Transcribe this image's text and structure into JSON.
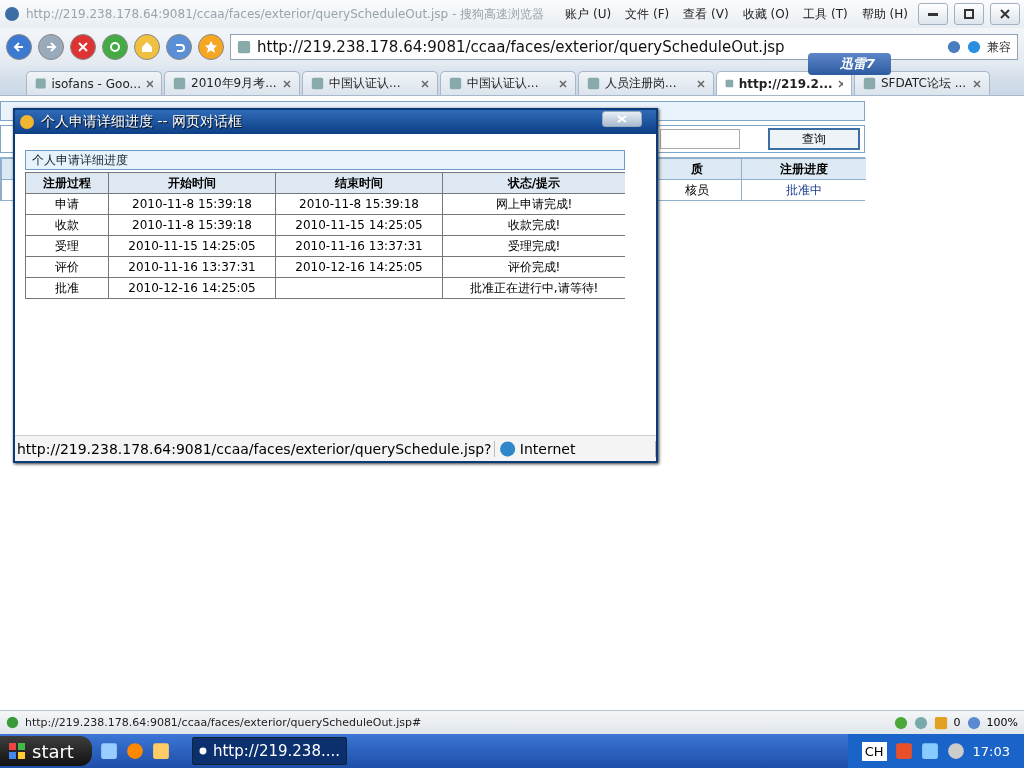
{
  "browser": {
    "title": "http://219.238.178.64:9081/ccaa/faces/exterior/queryScheduleOut.jsp - 搜狗高速浏览器",
    "menu": [
      {
        "label": "账户 (U)"
      },
      {
        "label": "文件 (F)"
      },
      {
        "label": "查看 (V)"
      },
      {
        "label": "收藏 (O)"
      },
      {
        "label": "工具 (T)"
      },
      {
        "label": "帮助 (H)"
      }
    ],
    "address": "http://219.238.178.64:9081/ccaa/faces/exterior/queryScheduleOut.jsp",
    "compat_label": "兼容",
    "download_badge": "迅雷7",
    "tabs": [
      {
        "label": "isofans - Goo...",
        "selected": false
      },
      {
        "label": "2010年9月考...",
        "selected": false
      },
      {
        "label": "中国认证认...",
        "selected": false
      },
      {
        "label": "中国认证认...",
        "selected": false
      },
      {
        "label": "人员注册岗...",
        "selected": false
      },
      {
        "label": "http://219.2...",
        "selected": true
      },
      {
        "label": "SFDATC论坛 ...",
        "selected": false
      }
    ],
    "status_url": "http://219.238.178.64:9081/ccaa/faces/exterior/queryScheduleOut.jsp#",
    "security_count": "0",
    "zoom": "100%"
  },
  "page": {
    "search_button": "查询",
    "columns": [
      "质",
      "注册进度"
    ],
    "rows": [
      [
        "核员",
        "批准中"
      ]
    ]
  },
  "dialog": {
    "title": "个人申请详细进度 -- 网页对话框",
    "section_title": "个人申请详细进度",
    "columns": [
      "注册过程",
      "开始时间",
      "结束时间",
      "状态/提示"
    ],
    "rows": [
      [
        "申请",
        "2010-11-8 15:39:18",
        "2010-11-8 15:39:18",
        "网上申请完成!"
      ],
      [
        "收款",
        "2010-11-8 15:39:18",
        "2010-11-15 14:25:05",
        "收款完成!"
      ],
      [
        "受理",
        "2010-11-15 14:25:05",
        "2010-11-16 13:37:31",
        "受理完成!"
      ],
      [
        "评价",
        "2010-11-16 13:37:31",
        "2010-12-16 14:25:05",
        "评价完成!"
      ],
      [
        "批准",
        "2010-12-16 14:25:05",
        "",
        "批准正在进行中,请等待!"
      ]
    ],
    "status_url": "http://219.238.178.64:9081/ccaa/faces/exterior/querySchedule.jsp?",
    "zone": "Internet"
  },
  "taskbar": {
    "start": "start",
    "task": "http://219.238....",
    "language": "CH",
    "clock": "17:03"
  }
}
